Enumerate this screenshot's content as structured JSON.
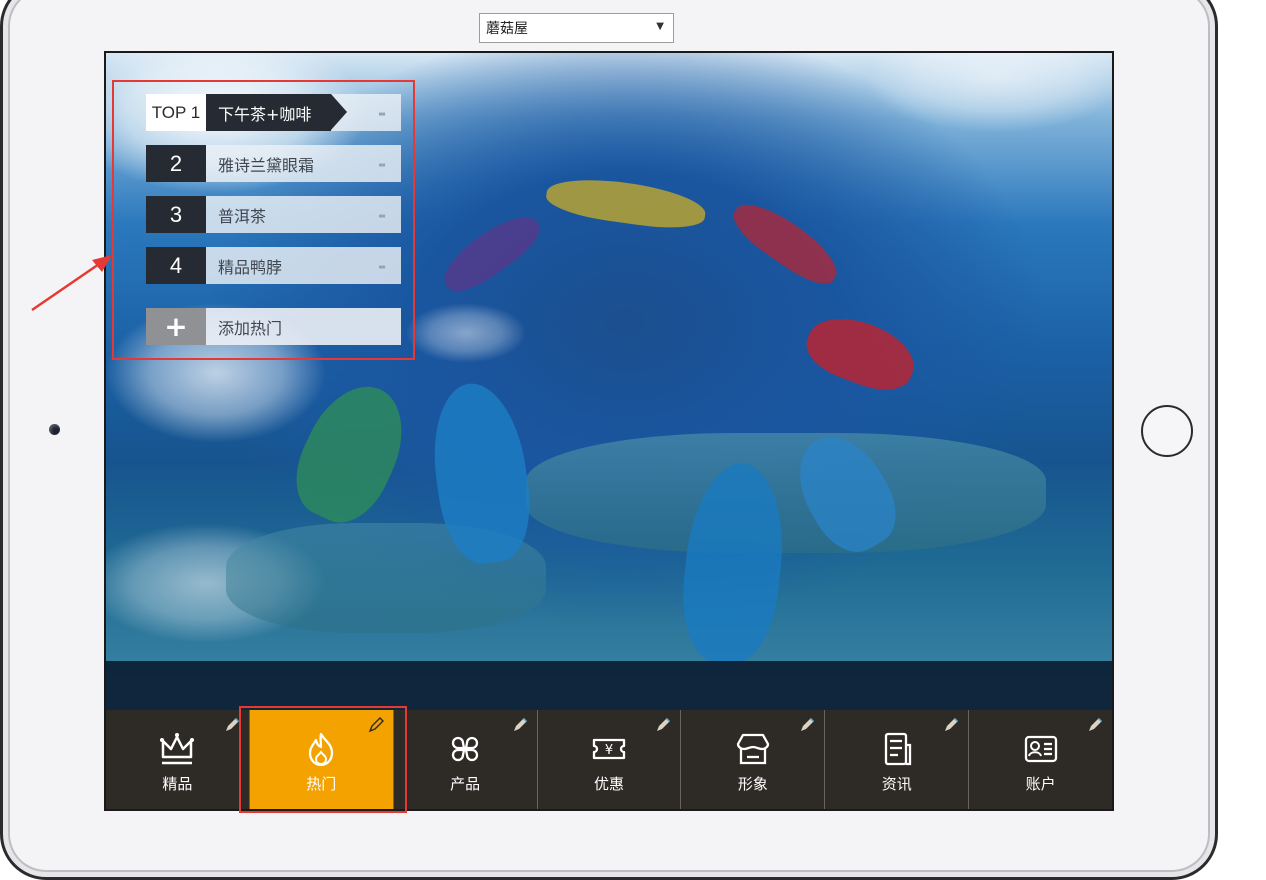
{
  "store_select": {
    "value": "蘑菇屋"
  },
  "hot_list": {
    "top1": {
      "label": "TOP 1",
      "name": "下午茶+咖啡"
    },
    "items": [
      {
        "rank": "2",
        "name": "雅诗兰黛眼霜"
      },
      {
        "rank": "3",
        "name": "普洱茶"
      },
      {
        "rank": "4",
        "name": "精品鸭脖"
      }
    ],
    "remove_symbol": "-",
    "add_label": "添加热门"
  },
  "nav": {
    "items": [
      {
        "label": "精品",
        "icon": "crown-icon"
      },
      {
        "label": "热门",
        "icon": "flame-icon",
        "active": true
      },
      {
        "label": "产品",
        "icon": "grid-icon"
      },
      {
        "label": "优惠",
        "icon": "coupon-icon"
      },
      {
        "label": "形象",
        "icon": "storefront-icon"
      },
      {
        "label": "资讯",
        "icon": "news-icon"
      },
      {
        "label": "账户",
        "icon": "id-card-icon"
      }
    ]
  },
  "colors": {
    "active_tab": "#f4a200",
    "nav_bg": "#2e2a26",
    "annotation_red": "#e53935",
    "dark_label": "#252a33"
  }
}
